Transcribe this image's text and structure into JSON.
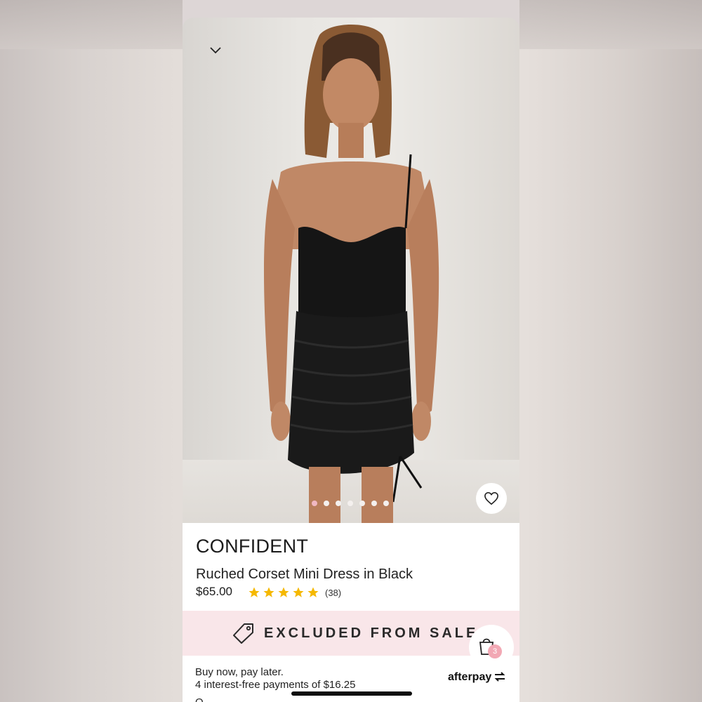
{
  "product": {
    "brand": "CONFIDENT",
    "title": "Ruched Corset Mini Dress in Black",
    "price": "$65.00",
    "rating": 5,
    "reviews": "(38)"
  },
  "gallery": {
    "image_count": 7,
    "active_index": 0
  },
  "icons": {
    "back": "chevron-down-icon",
    "favorite": "heart-icon",
    "tag": "tag-icon",
    "cart": "shopping-bag-icon"
  },
  "sale_banner": {
    "text": "EXCLUDED FROM SALE"
  },
  "cart": {
    "count": "3"
  },
  "afterpay": {
    "line1": "Buy now, pay later.",
    "line2": "4 interest-free payments of $16.25",
    "logo": "afterpay",
    "cut_text": "Q."
  },
  "colors": {
    "accent_pink": "#f2a8b4",
    "banner_bg": "#f9e6e9",
    "star": "#f5b800"
  }
}
